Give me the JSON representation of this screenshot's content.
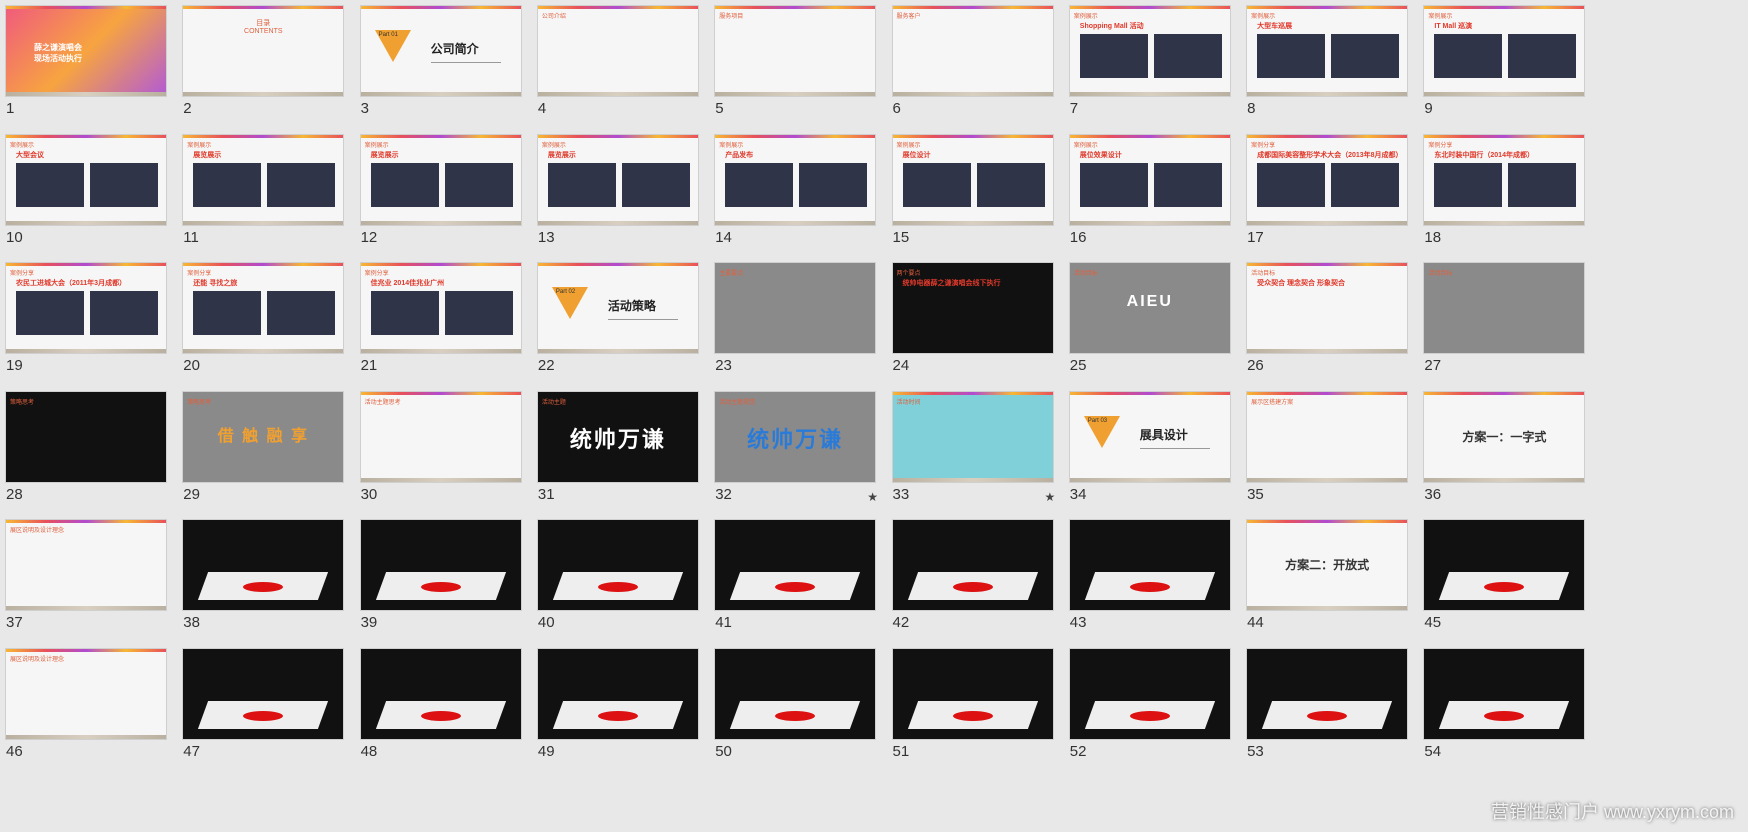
{
  "slides": [
    {
      "num": "1",
      "kind": "cover",
      "title": "薛之谦演唱会\n现场活动执行"
    },
    {
      "num": "2",
      "kind": "toc",
      "title": "目录",
      "sub": "CONTENTS"
    },
    {
      "num": "3",
      "kind": "part",
      "part": "Part 01",
      "title": "公司简介"
    },
    {
      "num": "4",
      "kind": "text",
      "hdr": "公司介绍"
    },
    {
      "num": "5",
      "kind": "text",
      "hdr": "服务项目"
    },
    {
      "num": "6",
      "kind": "logos",
      "hdr": "服务客户"
    },
    {
      "num": "7",
      "kind": "photos",
      "hdr": "案例展示",
      "sub": "Shopping  Mall 活动"
    },
    {
      "num": "8",
      "kind": "photos",
      "hdr": "案例展示",
      "sub": "大型车巡展"
    },
    {
      "num": "9",
      "kind": "photos",
      "hdr": "案例展示",
      "sub": "IT Mall 巡演"
    },
    {
      "num": "10",
      "kind": "photos",
      "hdr": "案例展示",
      "sub": "大型会议"
    },
    {
      "num": "11",
      "kind": "photos",
      "hdr": "案例展示",
      "sub": "展览展示"
    },
    {
      "num": "12",
      "kind": "photos",
      "hdr": "案例展示",
      "sub": "展览展示"
    },
    {
      "num": "13",
      "kind": "photos",
      "hdr": "案例展示",
      "sub": "展览展示"
    },
    {
      "num": "14",
      "kind": "photos",
      "hdr": "案例展示",
      "sub": "产品发布"
    },
    {
      "num": "15",
      "kind": "photos",
      "hdr": "案例展示",
      "sub": "展位设计"
    },
    {
      "num": "16",
      "kind": "photos",
      "hdr": "案例展示",
      "sub": "展位效果设计"
    },
    {
      "num": "17",
      "kind": "photos",
      "hdr": "案例分享",
      "sub": "成都国际美容整形学术大会（2013年8月成都）"
    },
    {
      "num": "18",
      "kind": "photos",
      "hdr": "案例分享",
      "sub": "东北时装中国行（2014年成都）"
    },
    {
      "num": "19",
      "kind": "photos",
      "hdr": "案例分享",
      "sub": "农民工进城大会（2011年3月成都）"
    },
    {
      "num": "20",
      "kind": "photos",
      "hdr": "案例分享",
      "sub": "还能  寻找之旅"
    },
    {
      "num": "21",
      "kind": "photos",
      "hdr": "案例分享",
      "sub": "佳兆业  2014佳兆业广州"
    },
    {
      "num": "22",
      "kind": "part",
      "part": "Part 02",
      "title": "活动策略"
    },
    {
      "num": "23",
      "kind": "photo",
      "hdr": "主要要点"
    },
    {
      "num": "24",
      "kind": "dark",
      "hdr": "两个要点",
      "sub": "统帅电器薛之谦演唱会线下执行"
    },
    {
      "num": "25",
      "kind": "photo",
      "hdr": "活动目标",
      "big": "AIEU"
    },
    {
      "num": "26",
      "kind": "text",
      "hdr": "活动目标",
      "sub": "受众契合  理念契合  形象契合"
    },
    {
      "num": "27",
      "kind": "photo",
      "hdr": "活动目标"
    },
    {
      "num": "28",
      "kind": "dark",
      "hdr": "策略思考"
    },
    {
      "num": "29",
      "kind": "photo",
      "hdr": "策略思考",
      "big": "借 触 融 享"
    },
    {
      "num": "30",
      "kind": "text",
      "hdr": "活动主题思考"
    },
    {
      "num": "31",
      "kind": "dark",
      "hdr": "活动主题",
      "big": "统帅万谦"
    },
    {
      "num": "32",
      "kind": "photo",
      "hdr": "活动主题视觉",
      "big": "统帅万谦",
      "star": "★"
    },
    {
      "num": "33",
      "kind": "map",
      "hdr": "活动时间",
      "star": "★"
    },
    {
      "num": "34",
      "kind": "part",
      "part": "Part 03",
      "title": "展具设计"
    },
    {
      "num": "35",
      "kind": "table",
      "hdr": "展示区搭建方案"
    },
    {
      "num": "36",
      "kind": "plain",
      "title": "方案一：一字式"
    },
    {
      "num": "37",
      "kind": "text",
      "hdr": "展区说明及设计理念"
    },
    {
      "num": "38",
      "kind": "render"
    },
    {
      "num": "39",
      "kind": "render"
    },
    {
      "num": "40",
      "kind": "render"
    },
    {
      "num": "41",
      "kind": "render"
    },
    {
      "num": "42",
      "kind": "render"
    },
    {
      "num": "43",
      "kind": "render"
    },
    {
      "num": "44",
      "kind": "plain",
      "title": "方案二：开放式"
    },
    {
      "num": "45",
      "kind": "render"
    },
    {
      "num": "46",
      "kind": "text",
      "hdr": "展区说明及设计理念"
    },
    {
      "num": "47",
      "kind": "render"
    },
    {
      "num": "48",
      "kind": "render"
    },
    {
      "num": "49",
      "kind": "render"
    },
    {
      "num": "50",
      "kind": "render"
    },
    {
      "num": "51",
      "kind": "render"
    },
    {
      "num": "52",
      "kind": "render"
    },
    {
      "num": "53",
      "kind": "render"
    },
    {
      "num": "54",
      "kind": "render"
    }
  ],
  "watermark": "营销性感门户 www.yxrym.com"
}
